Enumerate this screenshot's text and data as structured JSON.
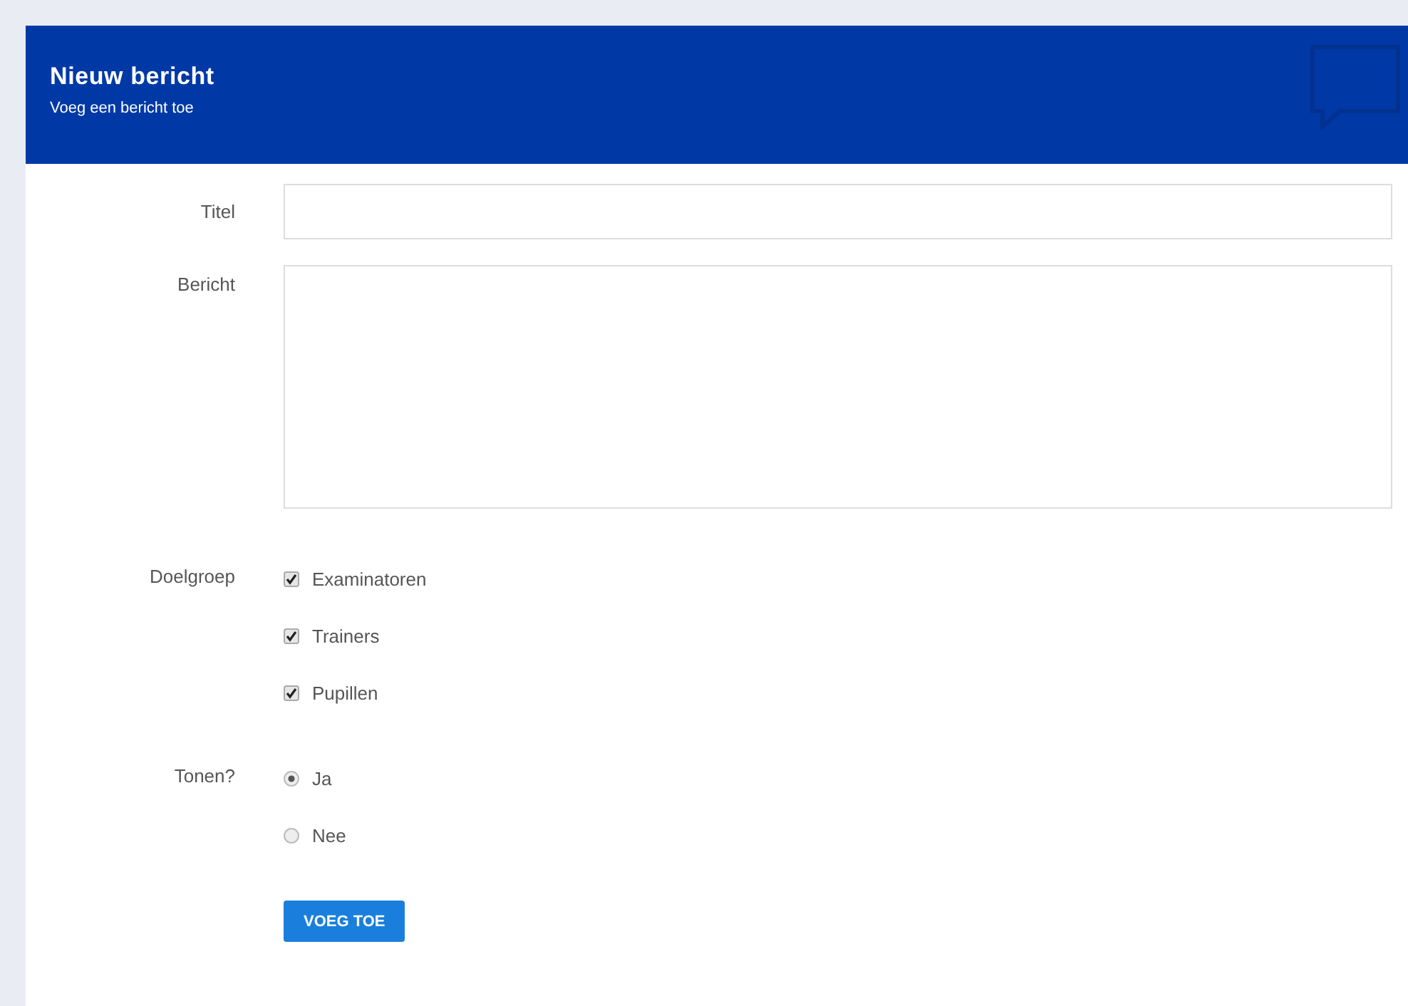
{
  "header": {
    "title": "Nieuw bericht",
    "subtitle": "Voeg een bericht toe"
  },
  "fields": [
    {
      "kind": "text",
      "label": "Titel"
    },
    {
      "kind": "textarea",
      "label": "Bericht"
    }
  ],
  "doelgroep": {
    "label": "Doelgroep",
    "options": [
      {
        "label": "Examinatoren",
        "checked": true
      },
      {
        "label": "Trainers",
        "checked": true
      },
      {
        "label": "Pupillen",
        "checked": true
      }
    ]
  },
  "tonen": {
    "label": "Tonen?",
    "options": [
      {
        "label": "Ja",
        "selected": true
      },
      {
        "label": "Nee",
        "selected": false
      }
    ]
  },
  "submit": "VOEG TOE"
}
